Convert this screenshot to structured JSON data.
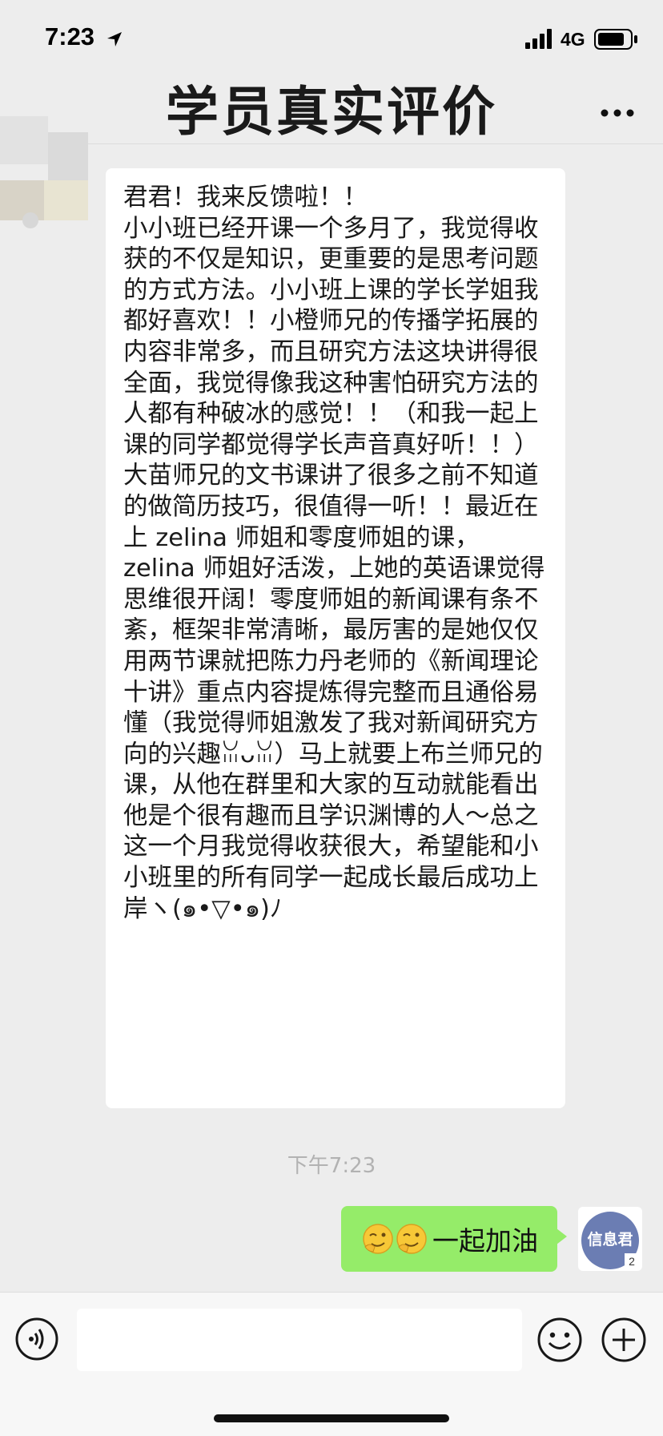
{
  "status_bar": {
    "time": "7:23",
    "network": "4G",
    "icons": [
      "location-arrow-icon",
      "signal-bars-icon",
      "battery-icon"
    ]
  },
  "nav": {
    "title": "学员真实评价",
    "more_icon": "more-dots-icon"
  },
  "messages": {
    "incoming": {
      "text": "君君！我来反馈啦！！\n小小班已经开课一个多月了，我觉得收获的不仅是知识，更重要的是思考问题的方式方法。小小班上课的学长学姐我都好喜欢！！小橙师兄的传播学拓展的内容非常多，而且研究方法这块讲得很全面，我觉得像我这种害怕研究方法的人都有种破冰的感觉！！（和我一起上课的同学都觉得学长声音真好听！！）大苗师兄的文书课讲了很多之前不知道的做简历技巧，很值得一听！！最近在上 zelina 师姐和零度师姐的课，zelina 师姐好活泼，上她的英语课觉得思维很开阔！零度师姐的新闻课有条不紊，框架非常清晰，最厉害的是她仅仅用两节课就把陈力丹老师的《新闻理论十讲》重点内容提炼得完整而且通俗易懂（我觉得师姐激发了我对新闻研究方向的兴趣ꈍᴗꈍ）马上就要上布兰师兄的课，从他在群里和大家的互动就能看出他是个很有趣而且学识渊博的人～总之这一个月我觉得收获很大，希望能和小小班里的所有同学一起成长最后成功上岸ヽ(๑•▽•๑)ﾉ"
    },
    "timestamp": "下午7:23",
    "outgoing": {
      "text": "一起加油",
      "emoji_icon": "wink-smile-emoji-icon"
    },
    "avatar": {
      "text": "信息君",
      "badge": "2"
    }
  },
  "input_bar": {
    "placeholder": "",
    "icons": [
      "voice-icon",
      "emoji-icon",
      "plus-icon"
    ]
  },
  "colors": {
    "background": "#ededed",
    "outgoing_bubble": "#95ec69",
    "incoming_bubble": "#ffffff",
    "timestamp": "#b2b2b2"
  }
}
